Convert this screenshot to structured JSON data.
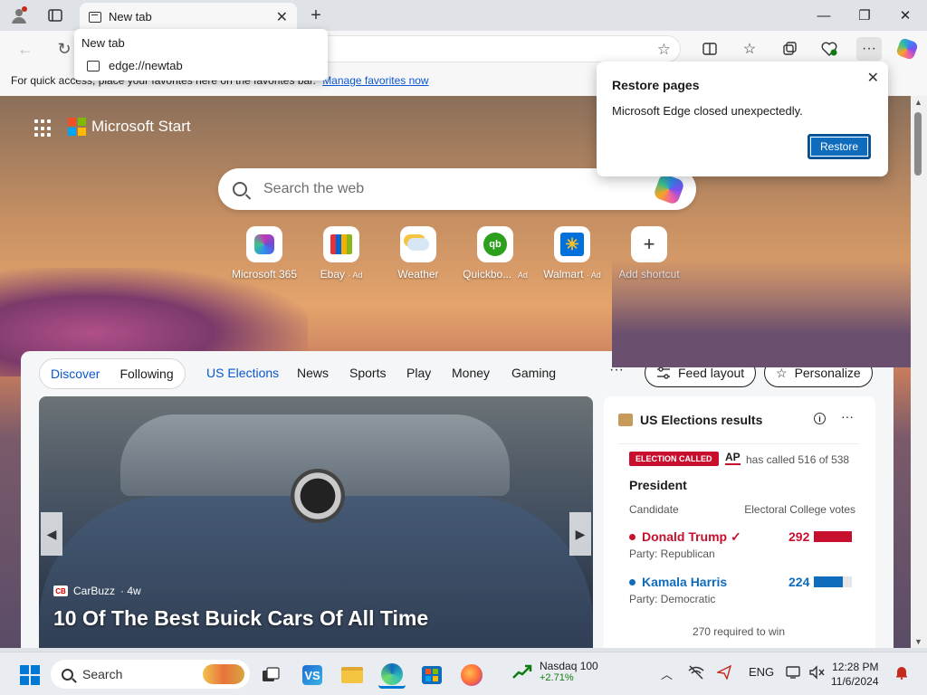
{
  "browser": {
    "tab": {
      "title": "New tab"
    },
    "tab_popup": {
      "title": "New tab",
      "url": "edge://newtab"
    },
    "favorites_bar": {
      "message": "For quick access, place your favorites here on the favorites bar.",
      "link": "Manage favorites now"
    }
  },
  "restore_dialog": {
    "title": "Restore pages",
    "message": "Microsoft Edge closed unexpectedly.",
    "button": "Restore"
  },
  "newtab": {
    "brand": "Microsoft Start",
    "search_placeholder": "Search the web",
    "shortcuts": [
      {
        "label": "Microsoft 365",
        "ad": ""
      },
      {
        "label": "Ebay",
        "ad": "· Ad"
      },
      {
        "label": "Weather",
        "ad": ""
      },
      {
        "label": "Quickbo...",
        "ad": "Ad"
      },
      {
        "label": "Walmart",
        "ad": "· Ad"
      },
      {
        "label": "Add shortcut",
        "ad": ""
      }
    ],
    "feed": {
      "pills": {
        "discover": "Discover",
        "following": "Following"
      },
      "tabs": [
        "US Elections",
        "News",
        "Sports",
        "Play",
        "Money",
        "Gaming"
      ],
      "more": "···",
      "feed_layout": "Feed layout",
      "personalize": "Personalize"
    },
    "hero": {
      "source": "CarBuzz",
      "source_logo": "CB",
      "age": "· 4w",
      "headline": "10 Of The Best Buick Cars Of All Time"
    },
    "elections": {
      "title": "US Elections results",
      "badge": "ELECTION CALLED",
      "ap": "AP",
      "ap_text": "has called 516 of 538",
      "race": "President",
      "col_candidate": "Candidate",
      "col_votes": "Electoral College votes",
      "candidates": [
        {
          "name": "Donald Trump ✓",
          "party": "Party: Republican",
          "votes": "292",
          "color": "#c8102e",
          "share": 1.0
        },
        {
          "name": "Kamala Harris",
          "party": "Party: Democratic",
          "votes": "224",
          "color": "#0f6cbd",
          "share": 0.77
        }
      ],
      "required": "270 required to win"
    }
  },
  "taskbar": {
    "search": "Search",
    "stock": {
      "name": "Nasdaq 100",
      "change": "+2.71%"
    },
    "lang": "ENG",
    "time": "12:28 PM",
    "date": "11/6/2024"
  },
  "colors": {
    "accent": "#0b57d0",
    "edge_blue": "#0f6cbd",
    "republican": "#c8102e",
    "democrat": "#0f6cbd"
  }
}
